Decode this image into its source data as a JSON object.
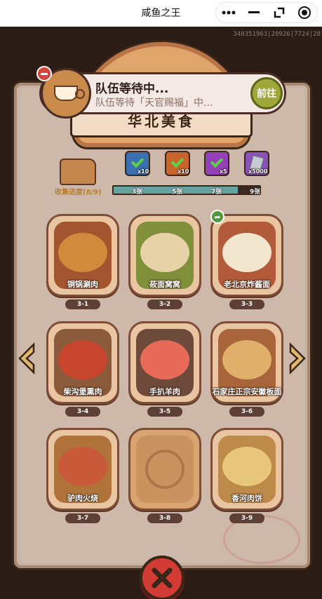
{
  "topbar": {
    "title": "咸鱼之王"
  },
  "build_id": "340351963|20926|7724|28",
  "header": {
    "title": "华北美食"
  },
  "notification": {
    "title": "队伍等待中...",
    "subtitle": "队伍等待「天官赐福」中...",
    "go_label": "前往"
  },
  "progress": {
    "label": "收集进度(8/9)",
    "fraction": 0.85,
    "ticks": [
      "3张",
      "5张",
      "7张",
      "9张"
    ],
    "rewards": [
      {
        "icon": "blue-check-chest-icon",
        "count": "x10",
        "color": "#3a6fb0"
      },
      {
        "icon": "orange-check-chest-icon",
        "count": "x10",
        "color": "#c8652d"
      },
      {
        "icon": "purple-check-chest-icon",
        "count": "x5",
        "color": "#9440b8"
      },
      {
        "icon": "crystal-gem-icon",
        "count": "x5000",
        "color": "#8a52b8"
      }
    ]
  },
  "cards": [
    {
      "name": "铜锅涮肉",
      "number": "3-1",
      "bg": "#a3552f",
      "dish": "#d08a3c"
    },
    {
      "name": "莜面窝窝",
      "number": "3-2",
      "bg": "#7f8f3a",
      "dish": "#e7d1a6"
    },
    {
      "name": "老北京炸酱面",
      "number": "3-3",
      "bg": "#b25a3a",
      "dish": "#f2e6cf"
    },
    {
      "name": "柴沟堡熏肉",
      "number": "3-4",
      "bg": "#8b5a3a",
      "dish": "#c8452d"
    },
    {
      "name": "手扒羊肉",
      "number": "3-5",
      "bg": "#6d4a3a",
      "dish": "#e86b5a"
    },
    {
      "name": "石家庄正宗安徽板面",
      "number": "3-6",
      "bg": "#a8643a",
      "dish": "#e0b06a"
    },
    {
      "name": "驴肉火烧",
      "number": "3-7",
      "bg": "#b0743a",
      "dish": "#c85a3a"
    },
    {
      "name": "",
      "number": "3-8",
      "bg": "#c9925f",
      "dish": ""
    },
    {
      "name": "香河肉饼",
      "number": "3-9",
      "bg": "#bd8a4a",
      "dish": "#e9c77a"
    }
  ]
}
